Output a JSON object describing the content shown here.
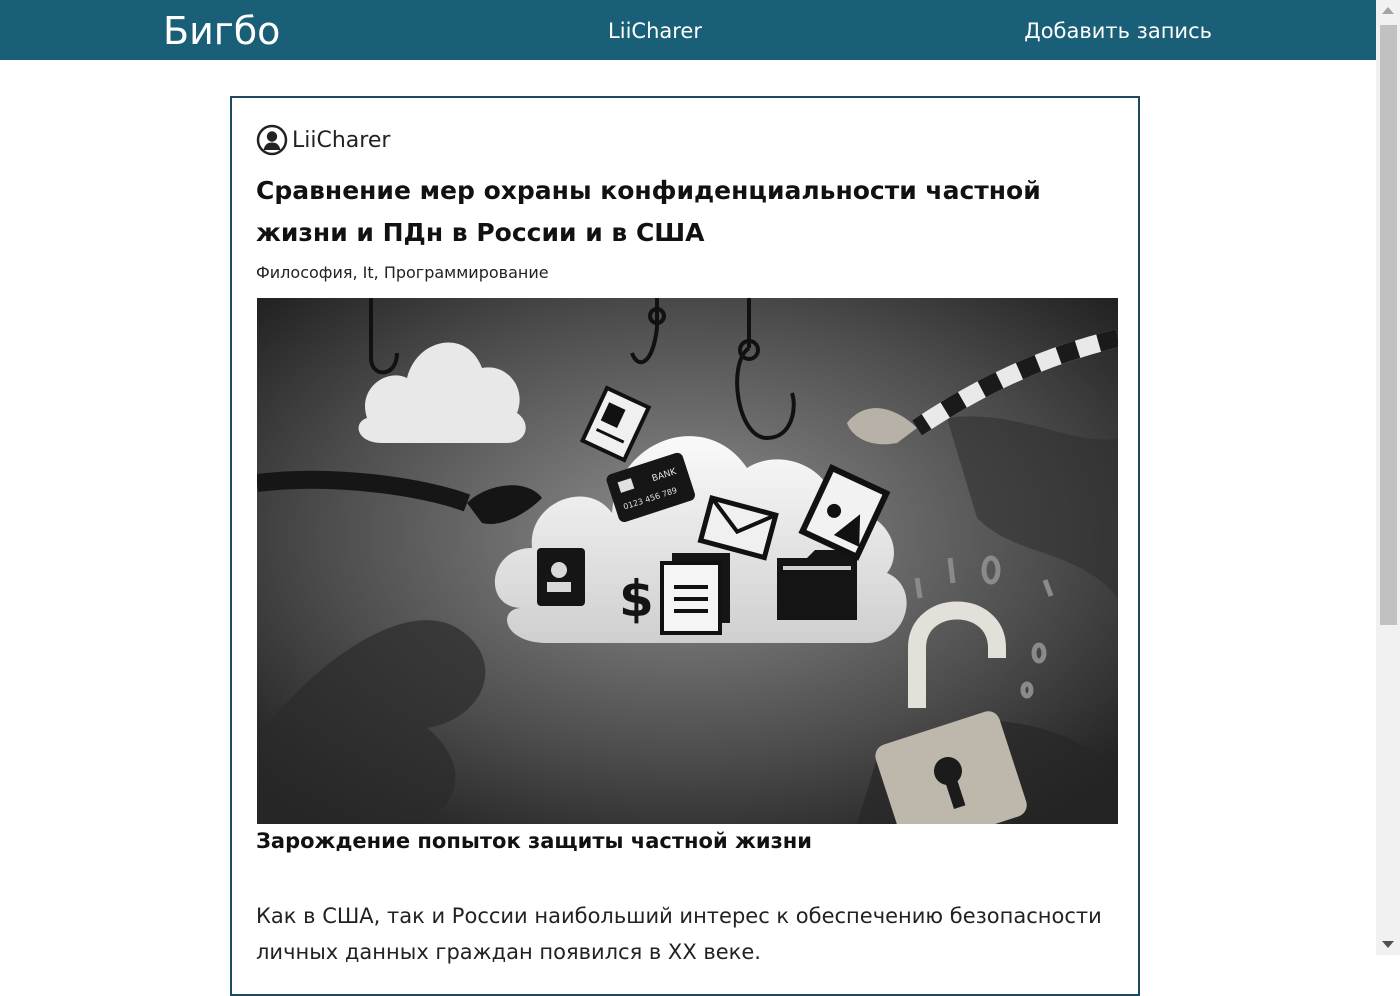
{
  "navbar": {
    "brand": "Бигбо",
    "user": "LiiCharer",
    "add_post": "Добавить запись"
  },
  "post": {
    "author": "LiiCharer",
    "title": "Сравнение мер охраны конфиденциальности частной жизни и ПДн в России и в США",
    "tags": "Философия, It, Программирование",
    "image_bank_text": "BANK",
    "image_card_number": "0123 456 789",
    "section_heading": "Зарождение попыток защиты частной жизни",
    "paragraph": "Как в США, так и России наибольший интерес к обеспечению безопасности личных данных граждан появился в XX веке."
  },
  "colors": {
    "navbar_bg": "#1a5f78",
    "card_border": "#1d4a5e"
  }
}
